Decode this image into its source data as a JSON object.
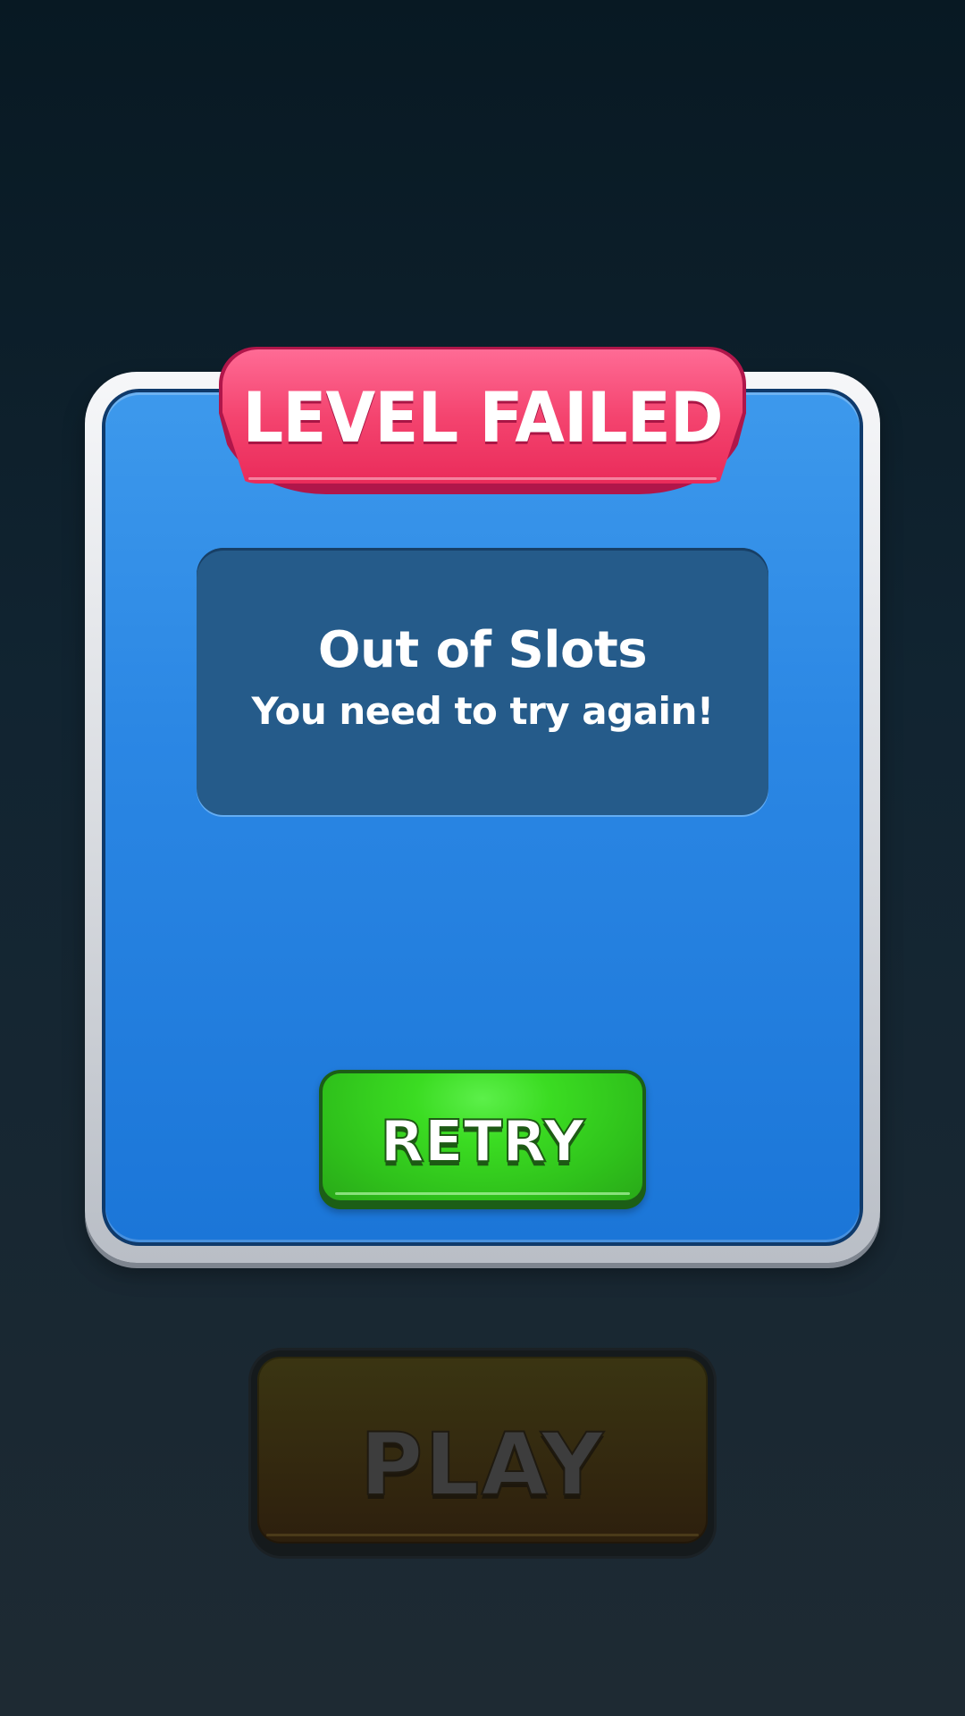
{
  "dialog": {
    "title": "LEVEL FAILED",
    "message_title": "Out of Slots",
    "message_subtitle": "You need to try again!",
    "retry_label": "RETRY"
  },
  "play_button": {
    "label": "PLAY",
    "state": "disabled"
  },
  "colors": {
    "background_top": "#081923",
    "background_bottom": "#1e2a33",
    "panel_blue": "#2b87e4",
    "message_box": "#255b8a",
    "title_ribbon": "#f4446f",
    "retry_green": "#3bdc22",
    "play_dim": "#33280f"
  }
}
